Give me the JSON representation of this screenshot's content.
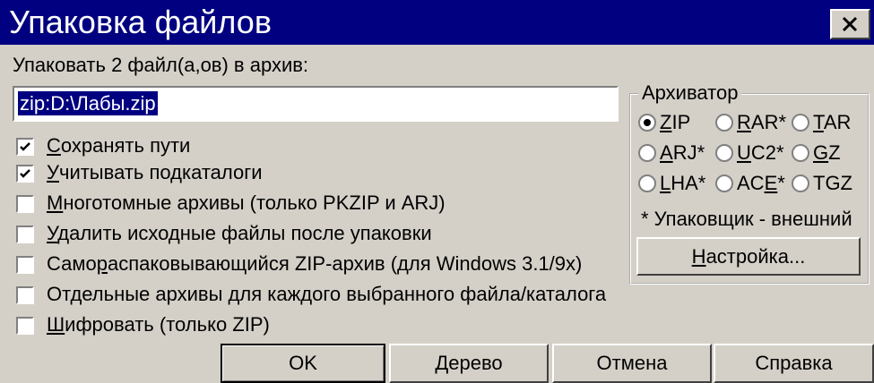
{
  "window": {
    "title": "Упаковка файлов",
    "close_icon": "close-icon"
  },
  "prompt": {
    "text": "Упаковать 2 файл(а,ов) в архив:"
  },
  "archive_path": {
    "value": "zip:D:\\Лабы.zip"
  },
  "options": [
    {
      "pre": "",
      "key": "С",
      "post": "охранять пути",
      "checked": true
    },
    {
      "pre": "",
      "key": "У",
      "post": "читывать подкаталоги",
      "checked": true
    },
    {
      "pre": "",
      "key": "М",
      "post": "ноготомные архивы (только PKZIP и ARJ)",
      "checked": false
    },
    {
      "pre": "",
      "key": "У",
      "post": "далить исходные файлы после упаковки",
      "checked": false
    },
    {
      "pre": "Само",
      "key": "р",
      "post": "аспаковывающийся ZIP-архив (для Windows 3.1/9x)",
      "checked": false
    },
    {
      "pre": "Отдельные архивы для каждого выбранного файла/каталога",
      "key": "",
      "post": "",
      "checked": false
    },
    {
      "pre": "",
      "key": "Ш",
      "post": "ифровать (только ZIP)",
      "checked": false
    }
  ],
  "archiver": {
    "title": "Архиватор",
    "options": [
      {
        "pre": "",
        "key": "Z",
        "post": "IP",
        "selected": true
      },
      {
        "pre": "",
        "key": "R",
        "post": "AR*",
        "selected": false
      },
      {
        "pre": "",
        "key": "T",
        "post": "AR",
        "selected": false
      },
      {
        "pre": "",
        "key": "A",
        "post": "RJ*",
        "selected": false
      },
      {
        "pre": "",
        "key": "U",
        "post": "C2*",
        "selected": false
      },
      {
        "pre": "",
        "key": "G",
        "post": "Z",
        "selected": false
      },
      {
        "pre": "",
        "key": "L",
        "post": "HA*",
        "selected": false
      },
      {
        "pre": "AC",
        "key": "E",
        "post": "*",
        "selected": false
      },
      {
        "pre": "TGZ",
        "key": "",
        "post": "",
        "selected": false
      }
    ],
    "note": "* Упаковщик - внешний",
    "settings_button": {
      "key": "Н",
      "post": "астройка..."
    }
  },
  "buttons": {
    "ok": "OK",
    "tree": {
      "key": "Д",
      "post": "ерево"
    },
    "cancel": "Отмена",
    "help": "Справка"
  }
}
